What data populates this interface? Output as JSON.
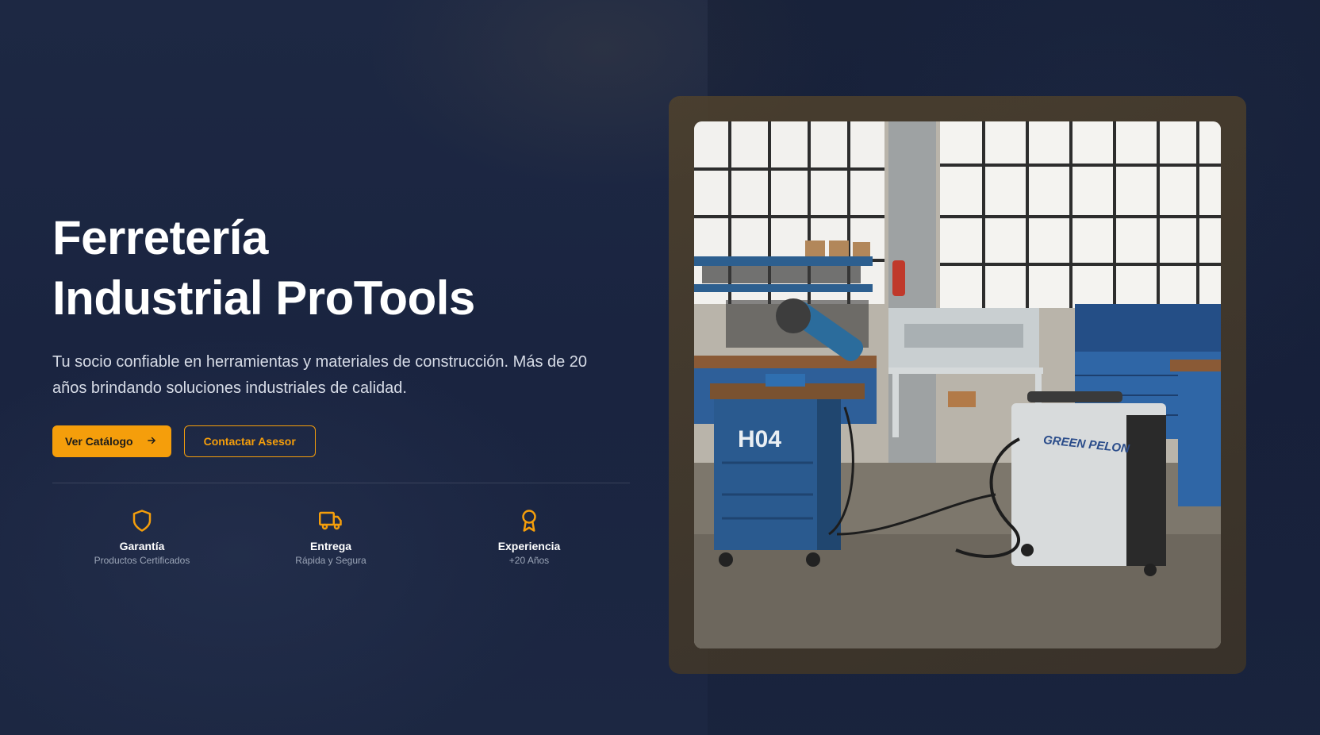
{
  "hero": {
    "title_line1": "Ferretería",
    "title_line2": "Industrial ProTools",
    "subtitle": "Tu socio confiable en herramientas y materiales de construcción. Más de 20 años brindando soluciones industriales de calidad.",
    "primary_button": "Ver Catálogo",
    "primary_button_icon": "arrow-right-icon",
    "secondary_button": "Contactar Asesor"
  },
  "features": [
    {
      "icon": "shield-icon",
      "title": "Garantía",
      "subtitle": "Productos Certificados"
    },
    {
      "icon": "truck-icon",
      "title": "Entrega",
      "subtitle": "Rápida y Segura"
    },
    {
      "icon": "award-icon",
      "title": "Experiencia",
      "subtitle": "+20 Años"
    }
  ],
  "image": {
    "cabinet_label": "H04",
    "welder_label": "GREEN PELON"
  },
  "colors": {
    "accent": "#f59e0b",
    "background": "#1b2540",
    "text": "#ffffff",
    "muted": "#9ca6b8"
  }
}
